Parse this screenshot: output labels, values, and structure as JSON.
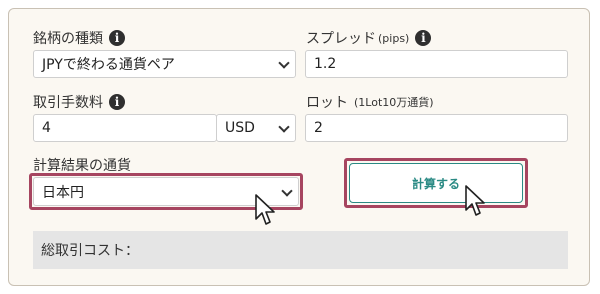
{
  "form": {
    "pair_type": {
      "label": "銘柄の種類",
      "selected": "JPYで終わる通貨ペア"
    },
    "spread": {
      "label": "スプレッド",
      "unit": "(pips)",
      "value": "1.2"
    },
    "commission": {
      "label": "取引手数料",
      "value": "4",
      "currency": "USD"
    },
    "lot": {
      "label": "ロット",
      "unit": "(1Lot10万通貨)",
      "value": "2"
    },
    "result_currency": {
      "label": "計算結果の通貨",
      "selected": "日本円"
    },
    "calculate_button": "計算する",
    "total_cost_label": "総取引コスト："
  },
  "colors": {
    "highlight": "#a64560",
    "button_accent": "#2a8a84",
    "card_background": "#fbf8f2"
  },
  "icons": {
    "info": "info-circle-icon",
    "cursor": "mouse-pointer-icon"
  }
}
